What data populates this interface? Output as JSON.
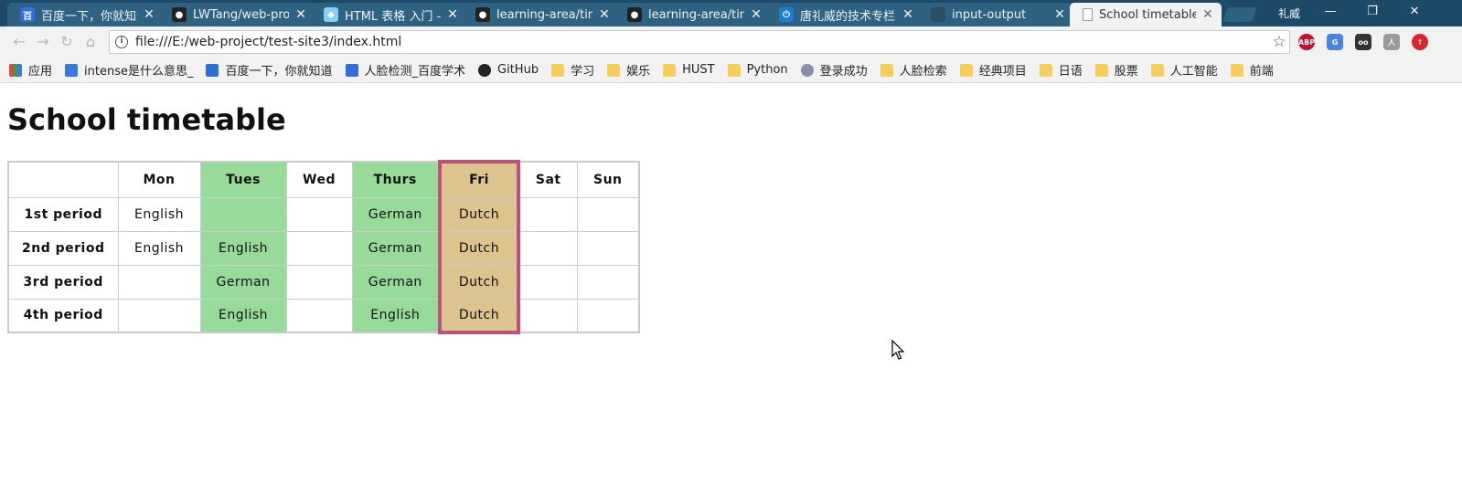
{
  "browser": {
    "tabs": [
      {
        "title": "百度一下，你就知道",
        "fav": "baidu-paw-icon",
        "color": "#2f6fd8",
        "glyph": "百"
      },
      {
        "title": "LWTang/web-proje",
        "fav": "github-icon",
        "color": "#222222",
        "glyph": "●"
      },
      {
        "title": "HTML 表格 入门 - 学",
        "fav": "mdn-icon",
        "color": "#83d0f2",
        "glyph": "◆"
      },
      {
        "title": "learning-area/time",
        "fav": "github-icon",
        "color": "#222222",
        "glyph": "●"
      },
      {
        "title": "learning-area/time",
        "fav": "github-icon",
        "color": "#222222",
        "glyph": "●"
      },
      {
        "title": "唐礼威的技术专栏",
        "fav": "power-icon",
        "color": "#1b7fd1",
        "glyph": "⏻"
      },
      {
        "title": "input-output",
        "fav": "page-icon",
        "color": "#2d4d63",
        "glyph": ""
      },
      {
        "title": "School timetable",
        "fav": "document-icon",
        "color": "#cfcfcf",
        "glyph": ""
      }
    ],
    "user_name": "礼威",
    "url": "file:///E:/web-project/test-site3/index.html",
    "bookmarks": [
      {
        "label": "应用",
        "icon": "apps-grid-icon",
        "color": "#e04a3a"
      },
      {
        "label": "intense是什么意思_",
        "icon": "search-icon",
        "color": "#3a7bd5"
      },
      {
        "label": "百度一下，你就知道",
        "icon": "baidu-paw-icon",
        "color": "#2f6fd8"
      },
      {
        "label": "人脸检测_百度学术",
        "icon": "baidu-paw-icon",
        "color": "#2f6fd8"
      },
      {
        "label": "GitHub",
        "icon": "github-icon",
        "color": "#222222"
      },
      {
        "label": "学习",
        "icon": "folder-icon",
        "color": "#f5cf57"
      },
      {
        "label": "娱乐",
        "icon": "folder-icon",
        "color": "#f5cf57"
      },
      {
        "label": "HUST",
        "icon": "folder-icon",
        "color": "#f5cf57"
      },
      {
        "label": "Python",
        "icon": "folder-icon",
        "color": "#f5cf57"
      },
      {
        "label": "登录成功",
        "icon": "globe-icon",
        "color": "#8a8fa8"
      },
      {
        "label": "人脸检索",
        "icon": "folder-icon",
        "color": "#f5cf57"
      },
      {
        "label": "经典项目",
        "icon": "folder-icon",
        "color": "#f5cf57"
      },
      {
        "label": "日语",
        "icon": "folder-icon",
        "color": "#f5cf57"
      },
      {
        "label": "股票",
        "icon": "folder-icon",
        "color": "#f5cf57"
      },
      {
        "label": "人工智能",
        "icon": "folder-icon",
        "color": "#f5cf57"
      },
      {
        "label": "前端",
        "icon": "folder-icon",
        "color": "#f5cf57"
      }
    ],
    "extensions": [
      {
        "name": "adblock-plus-icon",
        "label": "ABP",
        "color": "#c8102e"
      },
      {
        "name": "google-translate-icon",
        "label": "G",
        "color": "#4a82e6"
      },
      {
        "name": "tampermonkey-icon",
        "label": "oo",
        "color": "#333333"
      },
      {
        "name": "pdf-icon",
        "label": "人",
        "color": "#9a9a9a"
      },
      {
        "name": "upload-icon",
        "label": "↑",
        "color": "#d8262e"
      }
    ]
  },
  "page": {
    "title": "School timetable",
    "table": {
      "headers": [
        "",
        "Mon",
        "Tues",
        "Wed",
        "Thurs",
        "Fri",
        "Sat",
        "Sun"
      ],
      "rows": [
        {
          "period": "1st period",
          "cells": [
            "English",
            "",
            "",
            "German",
            "Dutch",
            "",
            ""
          ]
        },
        {
          "period": "2nd period",
          "cells": [
            "English",
            "English",
            "",
            "German",
            "Dutch",
            "",
            ""
          ]
        },
        {
          "period": "3rd period",
          "cells": [
            "",
            "German",
            "",
            "German",
            "Dutch",
            "",
            ""
          ]
        },
        {
          "period": "4th period",
          "cells": [
            "",
            "English",
            "",
            "English",
            "Dutch",
            "",
            ""
          ]
        }
      ],
      "colors": {
        "highlight_green": "#97db9a",
        "highlight_gold": "#dcc48e",
        "fri_border": "#c0507a"
      }
    }
  }
}
